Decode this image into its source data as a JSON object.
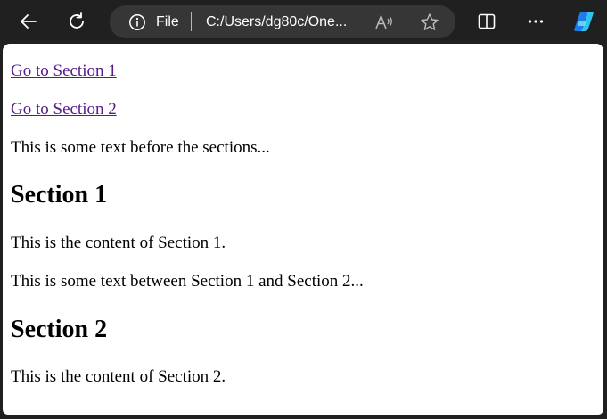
{
  "browser": {
    "address_bar": {
      "scheme_label": "File",
      "url": "C:/Users/dg80c/One..."
    },
    "icons": {
      "back": "back-arrow-icon",
      "refresh": "refresh-icon",
      "site_info": "info-icon",
      "read_aloud": "read-aloud-icon",
      "favorite": "star-icon",
      "split_screen": "split-screen-icon",
      "more": "more-dots-icon",
      "copilot": "copilot-icon"
    },
    "colors": {
      "chrome_background": "#202020",
      "address_bar_background": "#363636",
      "visited_link": "#551a8b",
      "copilot_blue": "#2b8cf0"
    }
  },
  "page": {
    "links": [
      {
        "label": "Go to Section 1"
      },
      {
        "label": "Go to Section 2"
      }
    ],
    "intro_text": "This is some text before the sections...",
    "sections": [
      {
        "heading": "Section 1",
        "content": "This is the content of Section 1."
      },
      {
        "heading": "Section 2",
        "content": "This is the content of Section 2."
      }
    ],
    "between_text": "This is some text between Section 1 and Section 2..."
  }
}
